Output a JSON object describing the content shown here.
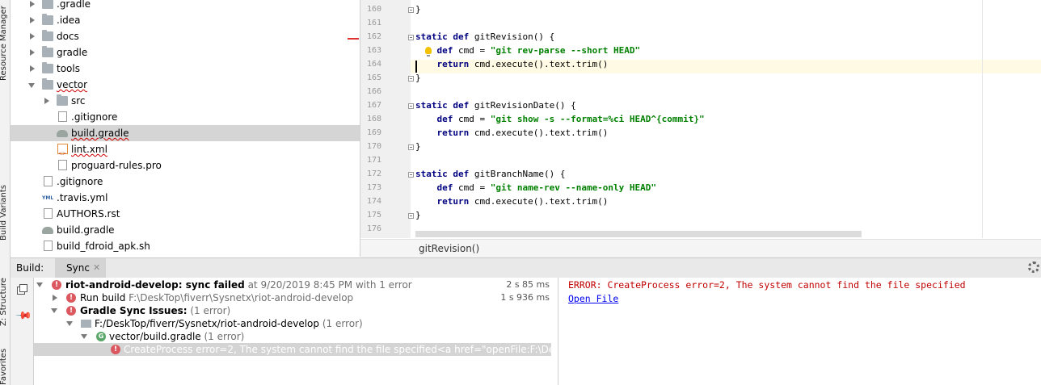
{
  "side_tabs": {
    "resource_manager": "Resource Manager",
    "build_variants": "Build Variants",
    "structure": "Z: Structure",
    "favorites": "Favorites"
  },
  "project_tree": {
    "items": [
      {
        "label": ".gradle",
        "type": "folder",
        "expand": "right"
      },
      {
        "label": ".idea",
        "type": "folder",
        "expand": "right"
      },
      {
        "label": "docs",
        "type": "folder",
        "expand": "right"
      },
      {
        "label": "gradle",
        "type": "folder",
        "expand": "right"
      },
      {
        "label": "tools",
        "type": "folder",
        "expand": "right"
      },
      {
        "label": "vector",
        "type": "folder",
        "expand": "down"
      },
      {
        "label": "src",
        "type": "folder",
        "expand": "right"
      },
      {
        "label": ".gitignore",
        "type": "file"
      },
      {
        "label": "build.gradle",
        "type": "gradle",
        "selected": true
      },
      {
        "label": "lint.xml",
        "type": "xml"
      },
      {
        "label": "proguard-rules.pro",
        "type": "file"
      },
      {
        "label": ".gitignore",
        "type": "file"
      },
      {
        "label": ".travis.yml",
        "type": "yml"
      },
      {
        "label": "AUTHORS.rst",
        "type": "file"
      },
      {
        "label": "build.gradle",
        "type": "gradle"
      },
      {
        "label": "build_fdroid_apk.sh",
        "type": "file"
      }
    ]
  },
  "editor": {
    "line_numbers": [
      "160",
      "161",
      "162",
      "163",
      "164",
      "165",
      "166",
      "167",
      "168",
      "169",
      "170",
      "171",
      "172",
      "173",
      "174",
      "175",
      "176"
    ],
    "lines": [
      {
        "kw": "",
        "rest": "}"
      },
      {
        "kw": "",
        "rest": ""
      },
      {
        "kw": "static def ",
        "rest": "gitRevision() {"
      },
      {
        "kw": "    def ",
        "rest": "cmd = ",
        "str": "\"git rev-parse --short HEAD\""
      },
      {
        "kw": "    return ",
        "rest": "cmd.execute().text.trim()"
      },
      {
        "kw": "",
        "rest": "}"
      },
      {
        "kw": "",
        "rest": ""
      },
      {
        "kw": "static def ",
        "rest": "gitRevisionDate() {"
      },
      {
        "kw": "    def ",
        "rest": "cmd = ",
        "str": "\"git show -s --format=%ci HEAD^{commit}\""
      },
      {
        "kw": "    return ",
        "rest": "cmd.execute().text.trim()"
      },
      {
        "kw": "",
        "rest": "}"
      },
      {
        "kw": "",
        "rest": ""
      },
      {
        "kw": "static def ",
        "rest": "gitBranchName() {"
      },
      {
        "kw": "    def ",
        "rest": "cmd = ",
        "str": "\"git name-rev --name-only HEAD\""
      },
      {
        "kw": "    return ",
        "rest": "cmd.execute().text.trim()"
      },
      {
        "kw": "",
        "rest": "}"
      },
      {
        "kw": "",
        "rest": ""
      }
    ],
    "breadcrumb": "gitRevision()"
  },
  "build_panel": {
    "title": "Build:",
    "tab_label": "Sync",
    "tab_close": "✕",
    "rows": [
      {
        "name": "riot-android-develop:",
        "status": " sync failed",
        "detail": " at 9/20/2019 8:45 PM  with 1 error",
        "time": "2 s 85 ms"
      },
      {
        "name": "Run build",
        "detail": " F:\\DeskTop\\fiverr\\Sysnetx\\riot-android-develop",
        "time": "1 s 936 ms"
      },
      {
        "name": "Gradle Sync Issues:",
        "detail": " (1 error)"
      },
      {
        "name": "F:/DeskTop/fiverr/Sysnetx/riot-android-develop",
        "detail": "  (1 error)"
      },
      {
        "name": "vector/build.gradle",
        "detail": "  (1 error)"
      },
      {
        "name": "CreateProcess error=2, The system cannot find the file specified<a href=\"openFile:F:\\De"
      }
    ]
  },
  "console": {
    "error_message": "ERROR: CreateProcess error=2, The system cannot find the file specified",
    "link": "Open File"
  },
  "colors": {
    "error": "#c00000",
    "keyword": "#000080",
    "string": "#008000",
    "link": "#0000ee",
    "selection": "#d5d5d5"
  }
}
